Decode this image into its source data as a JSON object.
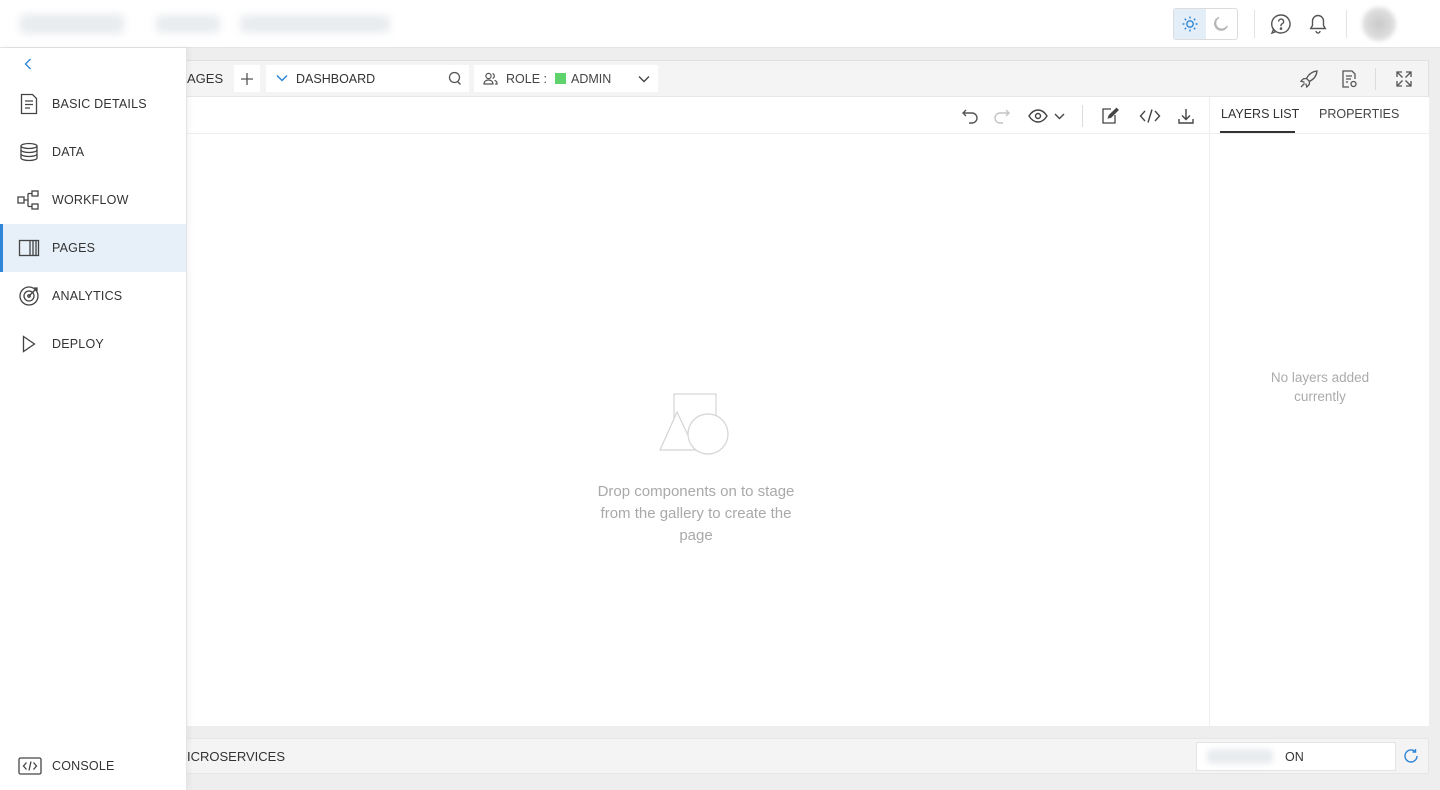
{
  "theme": {
    "accent": "#2f86d6",
    "active_bg": "#e7f0f8",
    "role_color": "#5fd36b"
  },
  "topbar": {
    "light_mode_icon": "sun-icon",
    "dark_mode_icon": "moon-icon",
    "help_icon": "help-icon",
    "notifications_icon": "bell-icon"
  },
  "sidebar": {
    "collapse_icon": "chevron-left-icon",
    "items": [
      {
        "label": "BASIC DETAILS",
        "icon": "document-icon"
      },
      {
        "label": "DATA",
        "icon": "database-icon"
      },
      {
        "label": "WORKFLOW",
        "icon": "workflow-icon"
      },
      {
        "label": "PAGES",
        "icon": "pages-icon",
        "active": true
      },
      {
        "label": "ANALYTICS",
        "icon": "target-icon"
      },
      {
        "label": "DEPLOY",
        "icon": "play-icon"
      }
    ],
    "console_label": "CONSOLE"
  },
  "editor": {
    "pages_tab_label": "AGES",
    "page_select_value": "DASHBOARD",
    "role_label": "ROLE :",
    "role_value": "ADMIN",
    "canvas_empty_message": "Drop components on to stage from the gallery to create the page"
  },
  "right_panel": {
    "tabs": [
      "LAYERS LIST",
      "PROPERTIES"
    ],
    "active_tab": "LAYERS LIST",
    "empty_message": "No layers added currently"
  },
  "bottombar": {
    "microservices_label": "ICROSERVICES",
    "status_value": "ON"
  }
}
